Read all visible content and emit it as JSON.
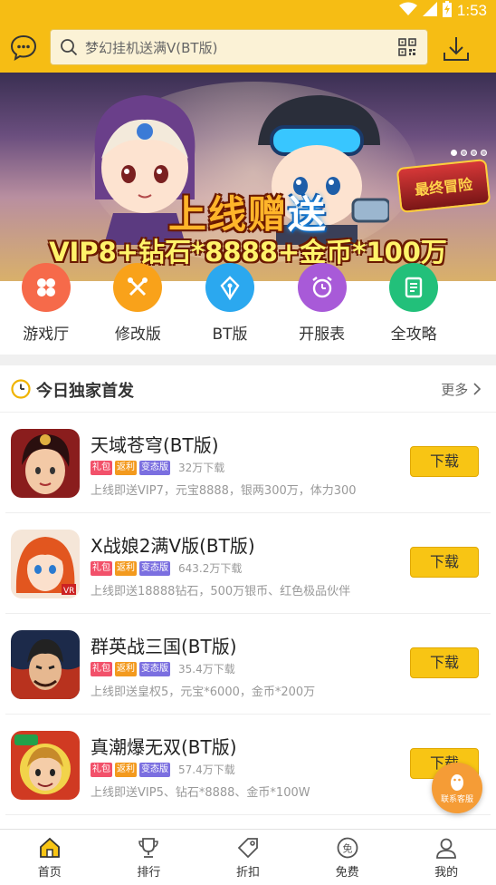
{
  "status_bar": {
    "time": "1:53"
  },
  "search": {
    "placeholder": "梦幻挂机送满V(BT版)"
  },
  "banner": {
    "headline_part1": "上线赠",
    "headline_part2": "送",
    "subline": "VIP8+钻石*8888+金币*100万",
    "logo_text": "最终冒险",
    "page_count": 4,
    "active_index": 0
  },
  "categories": [
    {
      "label": "游戏厅",
      "color": "#f66a4a",
      "icon": "grid-icon"
    },
    {
      "label": "修改版",
      "color": "#f9a21a",
      "icon": "tools-icon"
    },
    {
      "label": "BT版",
      "color": "#2ba8ef",
      "icon": "diamond-pen-icon"
    },
    {
      "label": "开服表",
      "color": "#a85ad8",
      "icon": "alarm-clock-icon"
    },
    {
      "label": "全攻略",
      "color": "#22c07a",
      "icon": "document-icon"
    }
  ],
  "section": {
    "title": "今日独家首发",
    "more": "更多"
  },
  "games": [
    {
      "name": "天域苍穹(BT版)",
      "downloads": "32万下载",
      "desc": "上线即送VIP7，元宝8888，银两300万，体力300",
      "button": "下载"
    },
    {
      "name": "X战娘2满V版(BT版)",
      "downloads": "643.2万下载",
      "desc": "上线即送18888钻石，500万银币、红色极品伙伴",
      "button": "下载"
    },
    {
      "name": "群英战三国(BT版)",
      "downloads": "35.4万下载",
      "desc": "上线即送皇权5，元宝*6000，金币*200万",
      "button": "下载"
    },
    {
      "name": "真潮爆无双(BT版)",
      "downloads": "57.4万下载",
      "desc": "上线即送VIP5、钻石*8888、金币*100W",
      "button": "下载"
    }
  ],
  "tags": [
    {
      "label": "礼包",
      "color": "#f2516a"
    },
    {
      "label": "返利",
      "color": "#f39a1e"
    },
    {
      "label": "变态版",
      "color": "#7b6fe0"
    }
  ],
  "service": {
    "label": "联系客服"
  },
  "nav": [
    {
      "label": "首页",
      "icon": "home-icon",
      "active": true
    },
    {
      "label": "排行",
      "icon": "trophy-icon"
    },
    {
      "label": "折扣",
      "icon": "tag-icon"
    },
    {
      "label": "免费",
      "icon": "free-icon"
    },
    {
      "label": "我的",
      "icon": "person-icon"
    }
  ]
}
